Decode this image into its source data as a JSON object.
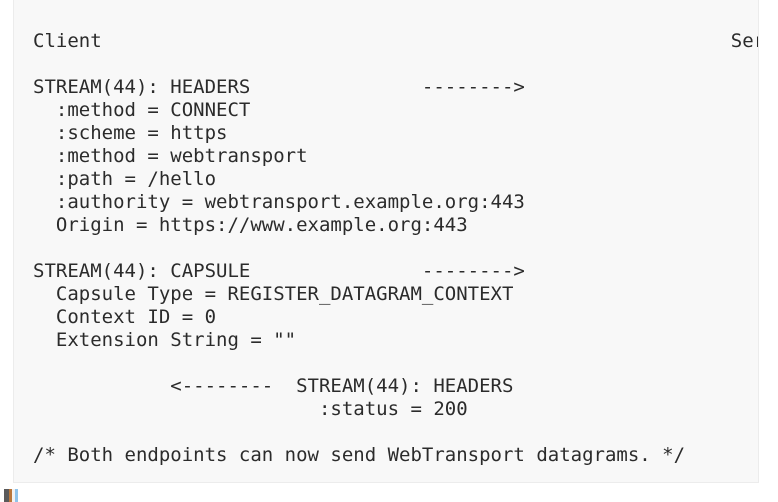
{
  "figure": {
    "kind": "protocol-flow-diagram",
    "background_color": "#f8f8f8",
    "border_color": "#ececec",
    "text_color": "#2b2b2b",
    "header": {
      "left_label": "Client",
      "right_label": "Server"
    },
    "lines": [
      "Client                                                       Server",
      "",
      "STREAM(44): HEADERS               -------->",
      "  :method = CONNECT",
      "  :scheme = https",
      "  :method = webtransport",
      "  :path = /hello",
      "  :authority = webtransport.example.org:443",
      "  Origin = https://www.example.org:443",
      "",
      "STREAM(44): CAPSULE               -------->",
      "  Capsule Type = REGISTER_DATAGRAM_CONTEXT",
      "  Context ID = 0",
      "  Extension String = \"\"",
      "",
      "            <--------  STREAM(44): HEADERS",
      "                         :status = 200",
      "",
      "/* Both endpoints can now send WebTransport datagrams. */"
    ],
    "messages": [
      {
        "stream": "STREAM(44): HEADERS",
        "direction": "-------->",
        "direction_name": "client-to-server",
        "fields": [
          ":method = CONNECT",
          ":scheme = https",
          ":method = webtransport",
          ":path = /hello",
          ":authority = webtransport.example.org:443",
          "Origin = https://www.example.org:443"
        ]
      },
      {
        "stream": "STREAM(44): CAPSULE",
        "direction": "-------->",
        "direction_name": "client-to-server",
        "fields": [
          "Capsule Type = REGISTER_DATAGRAM_CONTEXT",
          "Context ID = 0",
          "Extension String = \"\""
        ]
      },
      {
        "stream": "STREAM(44): HEADERS",
        "direction": "<--------",
        "direction_name": "server-to-client",
        "fields": [
          ":status = 200"
        ]
      }
    ],
    "comment": "/* Both endpoints can now send WebTransport datagrams. */"
  },
  "taskbar": {
    "favicon_name": "browser-tab-favicon"
  }
}
